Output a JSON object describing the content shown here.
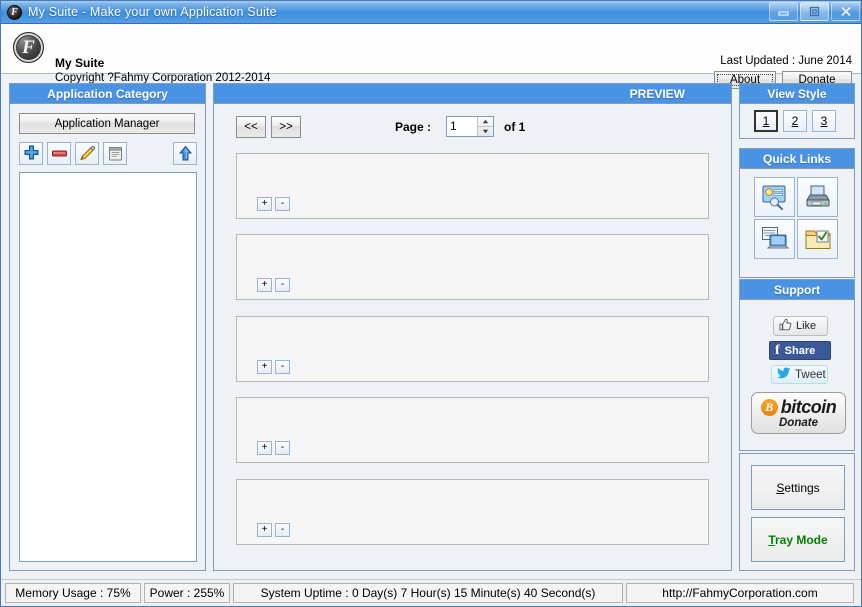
{
  "window": {
    "title": "My Suite - Make your own Application Suite",
    "logo_letter": "F",
    "controls": {
      "minimize": "minimize-icon",
      "restore": "restore-icon",
      "close": "close-icon"
    }
  },
  "header": {
    "logo_letter": "F",
    "app_name": "My Suite",
    "copyright": "Copyright ?Fahmy Corporation 2012-2014",
    "last_updated": "Last Updated : June 2014",
    "about_label": "About",
    "donate_label": "Donate"
  },
  "left_panel": {
    "title": "Application Category",
    "manager_button": "Application Manager",
    "toolbar": [
      {
        "name": "add-icon",
        "tooltip": "Add"
      },
      {
        "name": "remove-icon",
        "tooltip": "Remove"
      },
      {
        "name": "edit-pencil-icon",
        "tooltip": "Edit"
      },
      {
        "name": "notepad-icon",
        "tooltip": "Notes"
      },
      {
        "name": "move-up-arrow-icon",
        "tooltip": "Move Up"
      }
    ],
    "list_items": []
  },
  "center_panel": {
    "title": "PREVIEW",
    "prev_label": "<<",
    "next_label": ">>",
    "page_label": "Page :",
    "page_value": "1",
    "page_of": "of 1",
    "items": [
      {
        "plus": "+",
        "minus": "-"
      },
      {
        "plus": "+",
        "minus": "-"
      },
      {
        "plus": "+",
        "minus": "-"
      },
      {
        "plus": "+",
        "minus": "-"
      },
      {
        "plus": "+",
        "minus": "-"
      }
    ]
  },
  "view_style": {
    "title": "View Style",
    "options": [
      {
        "label": "1",
        "selected": true
      },
      {
        "label": "2",
        "selected": false
      },
      {
        "label": "3",
        "selected": false
      }
    ]
  },
  "quick_links": {
    "title": "Quick Links",
    "items": [
      {
        "name": "control-panel-icon"
      },
      {
        "name": "printers-devices-icon"
      },
      {
        "name": "system-tasks-icon"
      },
      {
        "name": "folder-check-icon"
      }
    ]
  },
  "support": {
    "title": "Support",
    "like_label": "Like",
    "share_label": "Share",
    "share_mark": "f",
    "tweet_label": "Tweet",
    "bitcoin_symbol": "B",
    "bitcoin_label": "bitcoin",
    "bitcoin_sub": "Donate"
  },
  "actions": {
    "settings_label": "Settings",
    "tray_label": "Tray Mode"
  },
  "status_bar": {
    "memory": "Memory Usage : 75%",
    "power": "Power : 255%",
    "uptime": "System Uptime : 0 Day(s) 7 Hour(s) 15 Minute(s) 40 Second(s)",
    "url": "http://FahmyCorporation.com"
  },
  "colors": {
    "titlebar_blue": "#3f8ddd",
    "panel_header_blue": "#4a92e4",
    "panel_border": "#7f9db9",
    "tray_green": "#008000",
    "facebook_blue": "#3b5998",
    "bitcoin_orange": "#e8860f"
  }
}
